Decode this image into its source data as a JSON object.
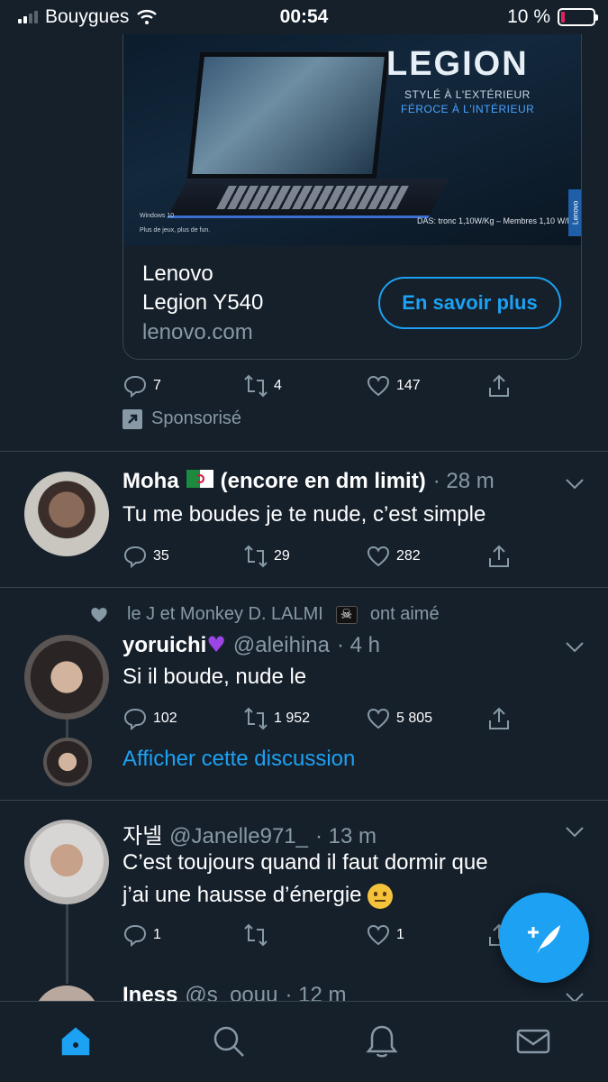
{
  "status_bar": {
    "carrier": "Bouygues",
    "time": "00:54",
    "battery": "10 %"
  },
  "ad": {
    "image": {
      "logo": "LEGION",
      "tagline1": "STYLÉ À L'EXTÉRIEUR",
      "tagline2": "FÉROCE À L'INTÉRIEUR",
      "os_label": "Windows 10",
      "os_sub": "Plus de jeux, plus de fun.",
      "das": "DAS: tronc 1,10W/Kg – Membres 1,10 W/Kg",
      "side_brand": "Lenovo"
    },
    "title_line1": "Lenovo",
    "title_line2": "Legion Y540",
    "domain": "lenovo.com",
    "cta": "En savoir plus",
    "replies": "7",
    "retweets": "4",
    "likes": "147",
    "sponsored_label": "Sponsorisé"
  },
  "tweets": [
    {
      "name": "Moha",
      "name_suffix": "(encore en dm limit)",
      "meta": "· 28 m",
      "text": "Tu me boudes je te nude, c’est simple",
      "replies": "35",
      "retweets": "29",
      "likes": "282"
    },
    {
      "liked_by": "le J et Monkey D. LALMI",
      "liked_suffix": "ont aimé",
      "name": "yoruichi",
      "handle": "@aleihina",
      "meta": "· 4 h",
      "text": "Si il boude, nude le",
      "replies": "102",
      "retweets": "1 952",
      "likes": "5 805",
      "show_thread": "Afficher cette discussion"
    },
    {
      "name": "자넬",
      "handle": "@Janelle971_",
      "meta": "· 13 m",
      "text_line1": "C’est toujours quand il faut dormir que",
      "text_line2": "j’ai une hausse d’énergie",
      "replies": "1",
      "retweets": "",
      "likes": "1"
    },
    {
      "name": "Iness",
      "handle": "@s_oouu",
      "meta": "· 12 m"
    }
  ],
  "colors": {
    "background": "#15202b",
    "accent": "#1da1f2",
    "muted": "#8899a6",
    "divider": "#38444d"
  },
  "icons": [
    "reply-icon",
    "retweet-icon",
    "like-icon",
    "share-icon",
    "home-icon",
    "search-icon",
    "notifications-icon",
    "messages-icon",
    "compose-icon",
    "chevron-down-icon"
  ]
}
